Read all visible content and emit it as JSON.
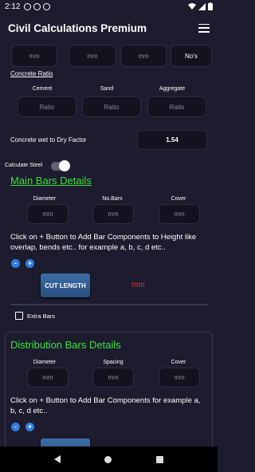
{
  "status": {
    "time": "2:12"
  },
  "app": {
    "title": "Civil Calculations Premium"
  },
  "top_fields": [
    "mm",
    "mm",
    "mm",
    "No's"
  ],
  "concrete_ratio": {
    "title": "Concrete Ratio",
    "labels": [
      "Cement",
      "Sand",
      "Aggregate"
    ],
    "placeholders": [
      "Ratio",
      "Ratio",
      "Ratio"
    ]
  },
  "wet_dry": {
    "label": "Concrete wet to Dry Factor",
    "value": "1.54"
  },
  "calc_steel": {
    "label": "Calculate Steel",
    "on": true
  },
  "main_bars": {
    "title": "Main Bars Details",
    "labels": [
      "Diameter",
      "No.Bars",
      "Cover"
    ],
    "placeholders": [
      "mm",
      "mm",
      "mm"
    ],
    "instruction": "Click on + Button to Add Bar Components to Height like overlap, bends etc.. for example a, b, c, d etc..",
    "minus": "-",
    "plus": "+",
    "cut_length_label": "CUT LENGTH",
    "unit": "mm"
  },
  "extra_bars": {
    "label": "Extra Bars"
  },
  "dist_bars": {
    "title": "Distribution Bars Details",
    "labels": [
      "Diameter",
      "Spacing",
      "Cover"
    ],
    "placeholders": [
      "mm",
      "mm",
      "mm"
    ],
    "instruction": "Click on + Button to Add Bar Components for example a, b, c, d etc..",
    "minus": "-",
    "plus": "+"
  },
  "colors": {
    "accent_green": "#3be03b",
    "unit_red": "#e53030",
    "button_blue": "#2f7de1"
  }
}
